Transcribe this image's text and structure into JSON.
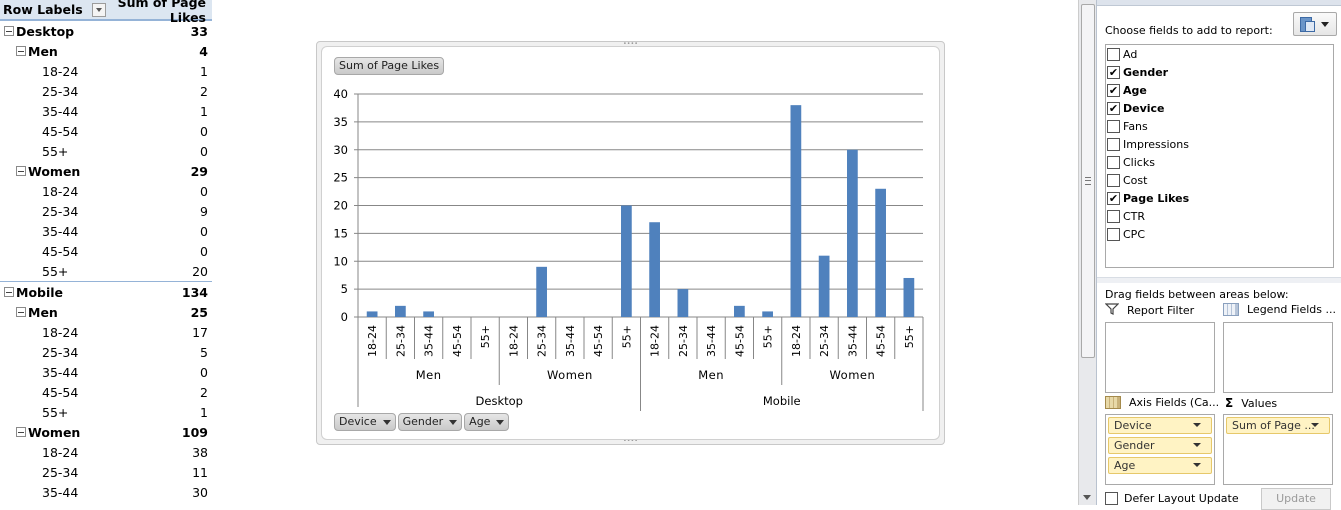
{
  "pivot_table": {
    "header": {
      "row_labels": "Row Labels",
      "value_header": "Sum of Page Likes"
    },
    "rows": [
      {
        "level": 0,
        "label": "Desktop",
        "value": "33"
      },
      {
        "level": 1,
        "label": "Men",
        "value": "4"
      },
      {
        "level": 2,
        "label": "18-24",
        "value": "1"
      },
      {
        "level": 2,
        "label": "25-34",
        "value": "2"
      },
      {
        "level": 2,
        "label": "35-44",
        "value": "1"
      },
      {
        "level": 2,
        "label": "45-54",
        "value": "0"
      },
      {
        "level": 2,
        "label": "55+",
        "value": "0"
      },
      {
        "level": 1,
        "label": "Women",
        "value": "29"
      },
      {
        "level": 2,
        "label": "18-24",
        "value": "0"
      },
      {
        "level": 2,
        "label": "25-34",
        "value": "9"
      },
      {
        "level": 2,
        "label": "35-44",
        "value": "0"
      },
      {
        "level": 2,
        "label": "45-54",
        "value": "0"
      },
      {
        "level": 2,
        "label": "55+",
        "value": "20"
      },
      {
        "level": 0,
        "label": "Mobile",
        "value": "134"
      },
      {
        "level": 1,
        "label": "Men",
        "value": "25"
      },
      {
        "level": 2,
        "label": "18-24",
        "value": "17"
      },
      {
        "level": 2,
        "label": "25-34",
        "value": "5"
      },
      {
        "level": 2,
        "label": "35-44",
        "value": "0"
      },
      {
        "level": 2,
        "label": "45-54",
        "value": "2"
      },
      {
        "level": 2,
        "label": "55+",
        "value": "1"
      },
      {
        "level": 1,
        "label": "Women",
        "value": "109"
      },
      {
        "level": 2,
        "label": "18-24",
        "value": "38"
      },
      {
        "level": 2,
        "label": "25-34",
        "value": "11"
      },
      {
        "level": 2,
        "label": "35-44",
        "value": "30"
      }
    ]
  },
  "chart": {
    "value_button": "Sum of Page Likes",
    "axis_buttons": [
      "Device",
      "Gender",
      "Age"
    ]
  },
  "chart_data": {
    "type": "bar",
    "title": "",
    "xlabel": "",
    "ylabel": "",
    "ylim": [
      0,
      40
    ],
    "yticks": [
      0,
      5,
      10,
      15,
      20,
      25,
      30,
      35,
      40
    ],
    "grid": true,
    "legend": "none",
    "bar_color": "#4f81bd",
    "levels": {
      "device": [
        {
          "label": "Desktop",
          "span": 10
        },
        {
          "label": "Mobile",
          "span": 10
        }
      ],
      "gender": [
        {
          "label": "Men",
          "span": 5
        },
        {
          "label": "Women",
          "span": 5
        },
        {
          "label": "Men",
          "span": 5
        },
        {
          "label": "Women",
          "span": 5
        }
      ]
    },
    "categories": [
      "18-24",
      "25-34",
      "35-44",
      "45-54",
      "55+",
      "18-24",
      "25-34",
      "35-44",
      "45-54",
      "55+",
      "18-24",
      "25-34",
      "35-44",
      "45-54",
      "55+",
      "18-24",
      "25-34",
      "35-44",
      "45-54",
      "55+"
    ],
    "series": [
      {
        "name": "Sum of Page Likes",
        "values": [
          1,
          2,
          1,
          0,
          0,
          0,
          9,
          0,
          0,
          20,
          17,
          5,
          0,
          2,
          1,
          38,
          11,
          30,
          23,
          7
        ]
      }
    ]
  },
  "field_list": {
    "choose_label": "Choose fields to add to report:",
    "fields": [
      {
        "label": "Ad",
        "checked": false
      },
      {
        "label": "Gender",
        "checked": true
      },
      {
        "label": "Age",
        "checked": true
      },
      {
        "label": "Device",
        "checked": true
      },
      {
        "label": "Fans",
        "checked": false
      },
      {
        "label": "Impressions",
        "checked": false
      },
      {
        "label": "Clicks",
        "checked": false
      },
      {
        "label": "Cost",
        "checked": false
      },
      {
        "label": "Page Likes",
        "checked": true
      },
      {
        "label": "CTR",
        "checked": false
      },
      {
        "label": "CPC",
        "checked": false
      }
    ],
    "drag_label": "Drag fields between areas below:",
    "areas": {
      "report_filter": {
        "label": "Report Filter",
        "items": []
      },
      "legend_fields": {
        "label": "Legend Fields ...",
        "items": []
      },
      "axis_fields": {
        "label": "Axis Fields (Ca...",
        "items": [
          "Device",
          "Gender",
          "Age"
        ]
      },
      "values": {
        "label": "Values",
        "items": [
          "Sum of Page ..."
        ]
      }
    },
    "defer_label": "Defer Layout Update",
    "update_label": "Update",
    "check_glyph": "✔",
    "sigma_glyph": "Σ"
  }
}
